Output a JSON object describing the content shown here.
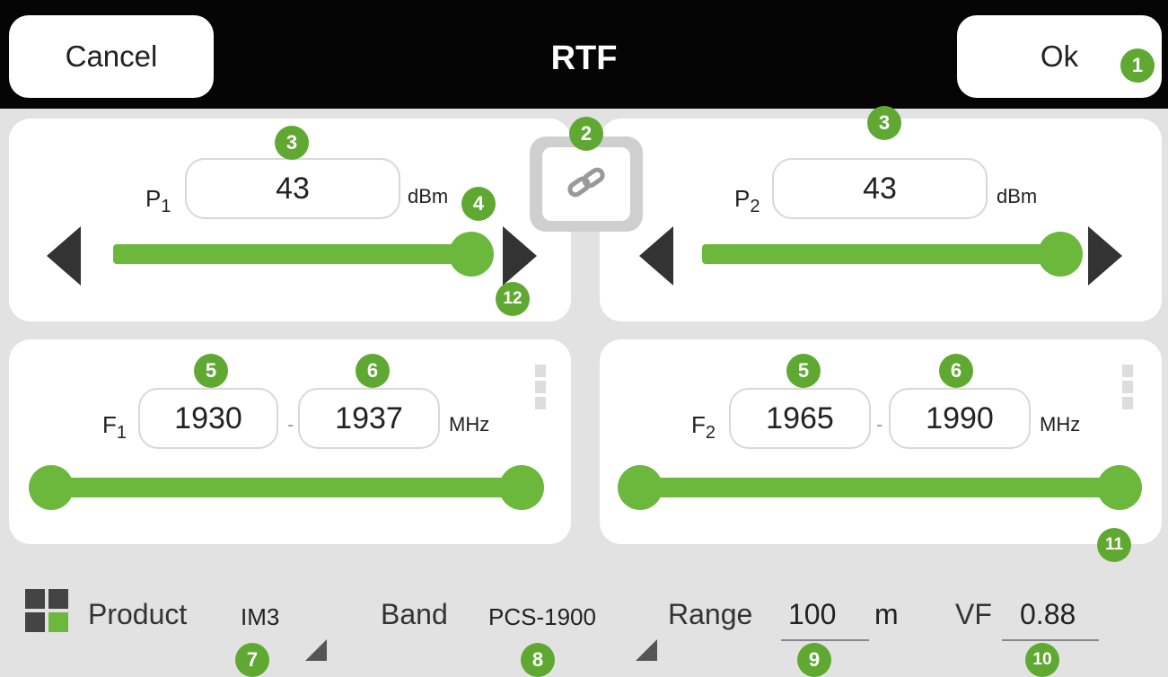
{
  "header": {
    "cancel_label": "Cancel",
    "title": "RTF",
    "ok_label": "Ok"
  },
  "power": {
    "p1": {
      "label": "P",
      "sub": "1",
      "value": "43",
      "unit": "dBm",
      "slider_fraction": 0.97
    },
    "p2": {
      "label": "P",
      "sub": "2",
      "value": "43",
      "unit": "dBm",
      "slider_fraction": 0.97
    }
  },
  "link_icon": "link-icon",
  "frequency": {
    "f1": {
      "label": "F",
      "sub": "1",
      "start": "1930",
      "separator": "-",
      "end": "1937",
      "unit": "MHz"
    },
    "f2": {
      "label": "F",
      "sub": "2",
      "start": "1965",
      "separator": "-",
      "end": "1990",
      "unit": "MHz"
    }
  },
  "bottom": {
    "product_label": "Product",
    "product_value": "IM3",
    "band_label": "Band",
    "band_value": "PCS-1900",
    "range_label": "Range",
    "range_value": "100",
    "range_unit": "m",
    "vf_label": "VF",
    "vf_value": "0.88"
  },
  "badges": [
    "1",
    "2",
    "3",
    "3",
    "4",
    "5",
    "6",
    "5",
    "6",
    "7",
    "8",
    "9",
    "10",
    "11",
    "12"
  ],
  "colors": {
    "accent": "#6bb83d",
    "badge": "#5fa933",
    "header_bg": "#050505",
    "arrow": "#333333"
  }
}
